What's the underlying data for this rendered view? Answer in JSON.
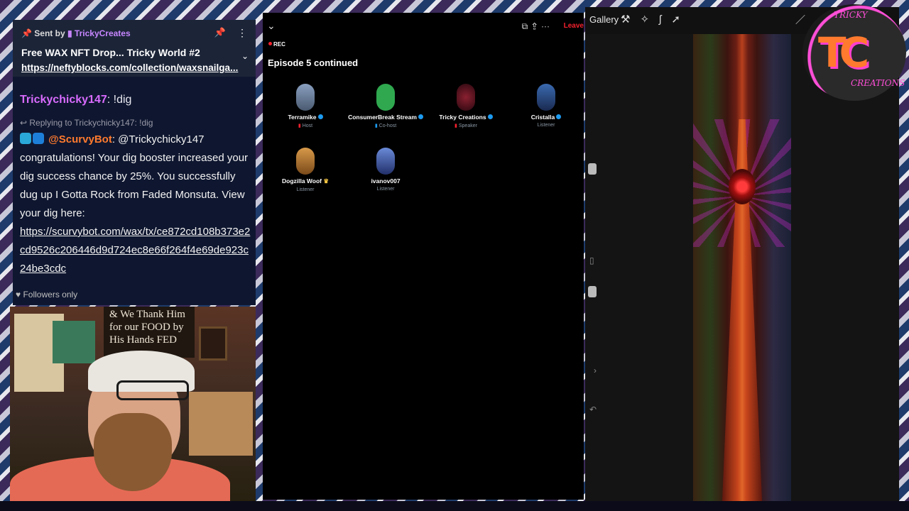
{
  "chat": {
    "pinned": {
      "sent_by_prefix": "Sent by",
      "sender": "TrickyCreates",
      "title": "Free WAX NFT Drop... Tricky World #2",
      "link": "https://neftyblocks.com/collection/waxsnailga..."
    },
    "message1": {
      "user": "Trickychicky147",
      "text": ": !dig"
    },
    "reply_to": "Replying to Trickychicky147: !dig",
    "message2": {
      "user": "@ScurvyBot",
      "text": ": @Trickychicky147 congratulations! Your dig booster increased your dig success chance by 25%. You successfully dug up I Gotta Rock from Faded Monsuta. View your dig here:",
      "link": "https://scurvybot.com/wax/tx/ce872cd108b373e2cd9526c206446d9d724ec8e66f264f4e69de923c24be3cdc"
    },
    "followers_only": "Followers only"
  },
  "webcam": {
    "sign_text": "& We Thank Him for our FOOD by His Hands FED"
  },
  "spaces": {
    "rec_label": "REC",
    "leave_label": "Leave",
    "episode_title": "Episode 5 continued",
    "participants": [
      {
        "name": "Terramike",
        "role": "Host",
        "color": "#6d7f99"
      },
      {
        "name": "ConsumerBreak Stream",
        "role": "Co-host",
        "color": "#2fa84f"
      },
      {
        "name": "Tricky Creations",
        "role": "Speaker",
        "color": "#4a1020"
      },
      {
        "name": "Cristalla",
        "role": "Listener",
        "color": "#2a4a8a"
      },
      {
        "name": "Dogzilla Woof",
        "role": "Listener",
        "color": "#b9772e"
      },
      {
        "name": "ivanov007",
        "role": "Listener",
        "color": "#3e5aa8"
      }
    ]
  },
  "procreate": {
    "gallery_label": "Gallery"
  },
  "logo": {
    "top_text": "TRICKY",
    "letters": "TC",
    "bottom_text": "CREATIONS"
  }
}
